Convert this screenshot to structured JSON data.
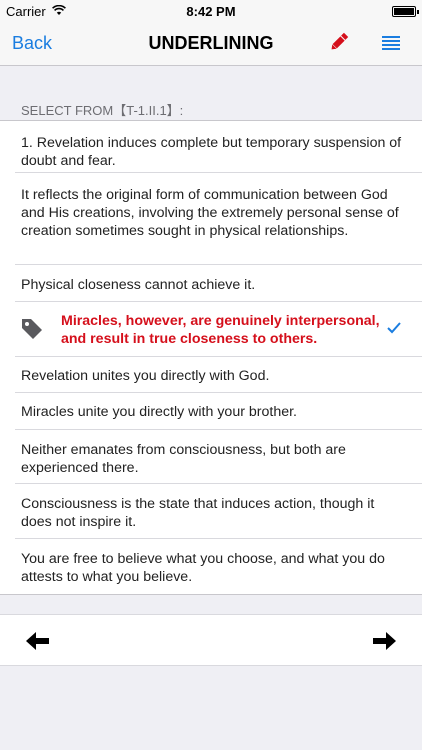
{
  "status_bar": {
    "carrier": "Carrier",
    "time": "8:42 PM"
  },
  "nav_bar": {
    "back_label": "Back",
    "title": "UNDERLINING"
  },
  "section_header": "SELECT FROM【T-1.II.1】:",
  "paragraphs": [
    "1. Revelation induces complete but temporary suspension of doubt and fear.",
    "It reflects the original form of communication  between God and His creations, involving the extremely personal sense of creation sometimes sought in physical relationships.",
    "Physical closeness cannot achieve it.",
    "Miracles, however, are genuinely interpersonal, and result in true  closeness to others.",
    "Revelation unites you directly with God.",
    "Miracles unite you directly with your brother.",
    "Neither  emanates from consciousness, but both are experienced there.",
    "Consciousness is the state that induces action, though it does  not inspire it.",
    "You are free to believe what you choose, and what you do attests to what you believe."
  ],
  "selected_index": 3,
  "colors": {
    "accent": "#1a7de0",
    "highlight": "#d50f1b"
  },
  "icons": [
    "wifi-icon",
    "battery-icon",
    "pencil-icon",
    "list-icon",
    "tag-icon",
    "checkmark-icon",
    "arrow-left-icon",
    "arrow-right-icon"
  ]
}
